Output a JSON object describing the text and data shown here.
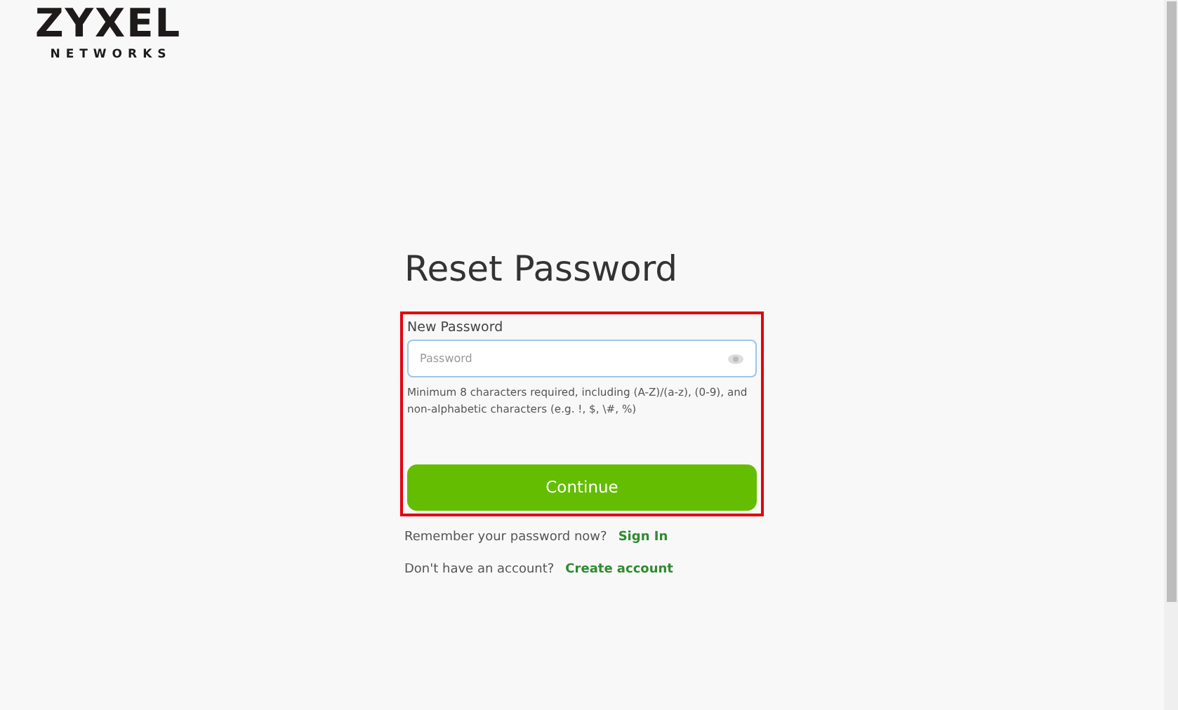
{
  "logo": {
    "name": "ZYXEL",
    "tagline": "NETWORKS"
  },
  "title": "Reset Password",
  "highlighted": true,
  "field": {
    "label": "New Password",
    "placeholder": "Password"
  },
  "hint": "Minimum 8 characters required, including (A-Z)/(a-z), (0-9), and non-alphabetic characters (e.g. !, $, \\#, %)",
  "button": "Continue",
  "links": [
    {
      "text": "Remember your password now?",
      "link": "Sign In"
    },
    {
      "text": "Don't have an account?",
      "link": "Create account"
    }
  ]
}
